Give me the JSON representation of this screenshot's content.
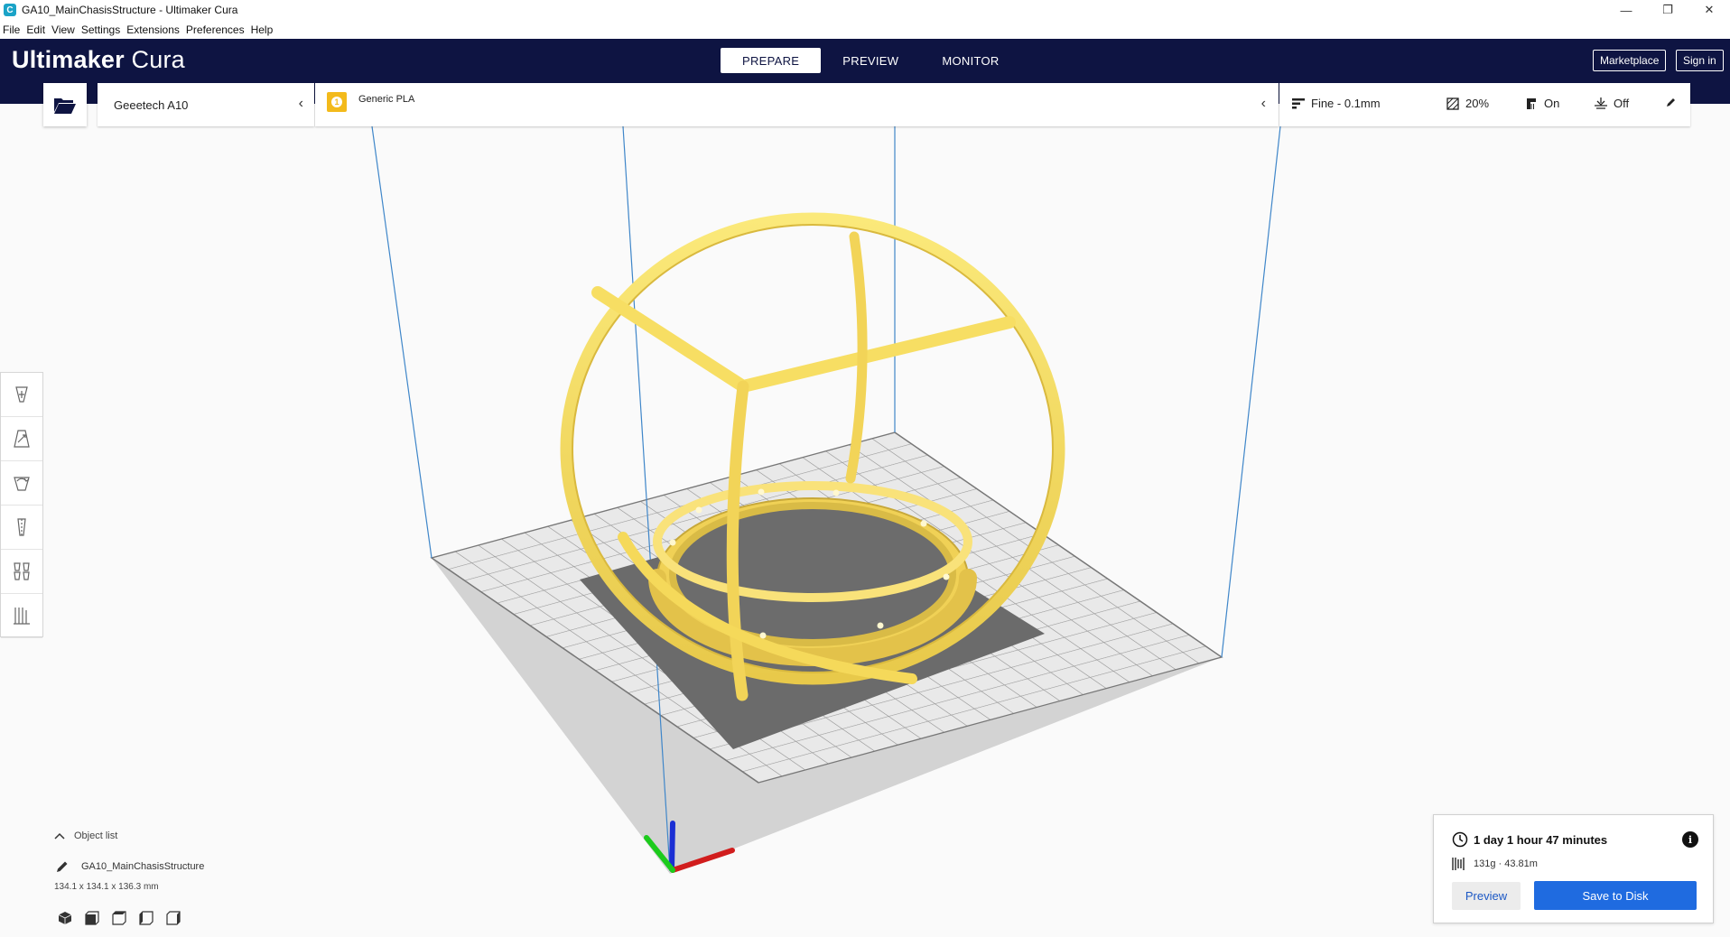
{
  "window": {
    "title": "GA10_MainChasisStructure - Ultimaker Cura",
    "controls": [
      "—",
      "❐",
      "✕"
    ]
  },
  "menu": [
    "File",
    "Edit",
    "View",
    "Settings",
    "Extensions",
    "Preferences",
    "Help"
  ],
  "header": {
    "logo_bold": "Ultimaker",
    "logo_light": " Cura",
    "stages": [
      "PREPARE",
      "PREVIEW",
      "MONITOR"
    ],
    "active_stage": "PREPARE",
    "marketplace_label": "Marketplace",
    "signin_label": "Sign in",
    "bg_color": "#0e1442"
  },
  "printer": {
    "name": "Geeetech A10"
  },
  "material": {
    "name": "Generic PLA",
    "color": "#f3ba1b"
  },
  "settings": {
    "profile": "Fine - 0.1mm",
    "infill": "20%",
    "support": "On",
    "adhesion": "Off"
  },
  "object_list": {
    "toggle_label": "Object list",
    "object_name": "GA10_MainChasisStructure",
    "dimensions": "134.1 x 134.1 x 136.3 mm"
  },
  "print_info": {
    "time": "1 day 1 hour 47 minutes",
    "material_usage": "131g · 43.81m",
    "preview_label": "Preview",
    "save_label": "Save to Disk",
    "accent": "#1f6be0"
  },
  "model": {
    "color": "#f5de60"
  }
}
